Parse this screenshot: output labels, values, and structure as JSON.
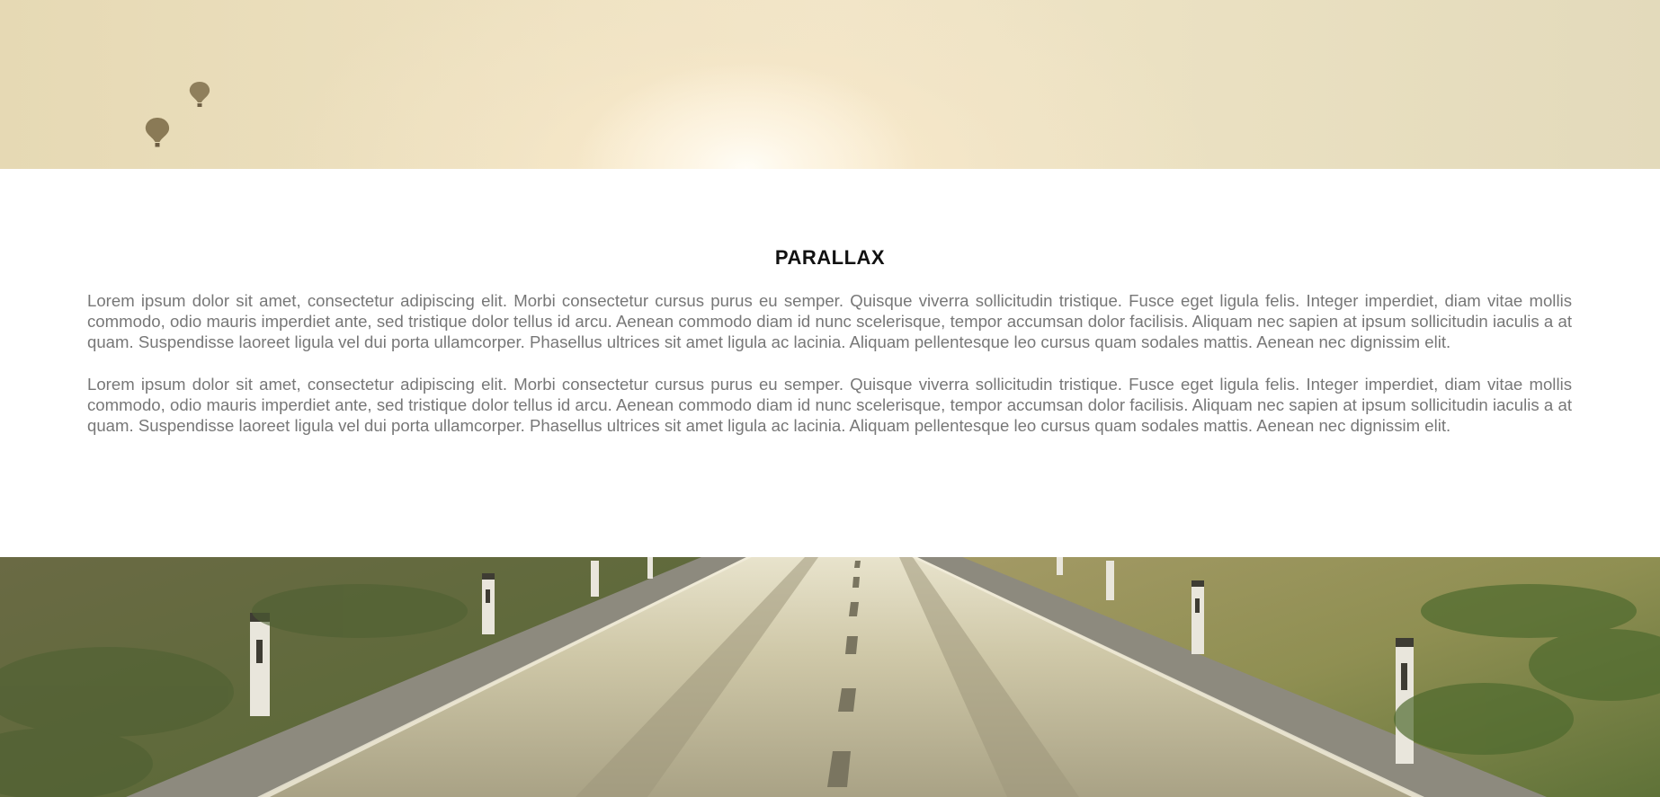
{
  "sections": {
    "top_image": {
      "description_icon": "hot-air-balloon-icon"
    },
    "content": {
      "title": "PARALLAX",
      "paragraphs": [
        "Lorem ipsum dolor sit amet, consectetur adipiscing elit. Morbi consectetur cursus purus eu semper. Quisque viverra sollicitudin tristique. Fusce eget ligula felis. Integer imperdiet, diam vitae mollis commodo, odio mauris imperdiet ante, sed tristique dolor tellus id arcu. Aenean commodo diam id nunc scelerisque, tempor accumsan dolor facilisis. Aliquam nec sapien at ipsum sollicitudin iaculis a at quam. Suspendisse laoreet ligula vel dui porta ullamcorper. Phasellus ultrices sit amet ligula ac lacinia. Aliquam pellentesque leo cursus quam sodales mattis. Aenean nec dignissim elit.",
        "Lorem ipsum dolor sit amet, consectetur adipiscing elit. Morbi consectetur cursus purus eu semper. Quisque viverra sollicitudin tristique. Fusce eget ligula felis. Integer imperdiet, diam vitae mollis commodo, odio mauris imperdiet ante, sed tristique dolor tellus id arcu. Aenean commodo diam id nunc scelerisque, tempor accumsan dolor facilisis. Aliquam nec sapien at ipsum sollicitudin iaculis a at quam. Suspendisse laoreet ligula vel dui porta ullamcorper. Phasellus ultrices sit amet ligula ac lacinia. Aliquam pellentesque leo cursus quam sodales mattis. Aenean nec dignissim elit."
      ]
    }
  },
  "colors": {
    "title": "#111111",
    "body_text": "#777777",
    "background": "#ffffff"
  }
}
